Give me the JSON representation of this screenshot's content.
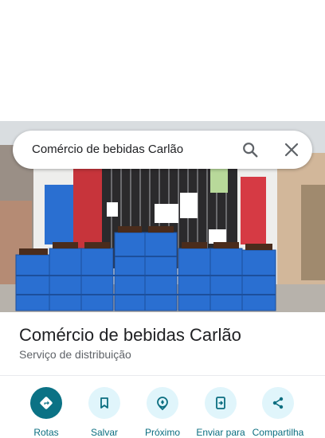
{
  "search": {
    "query": "Comércio de bebidas Carlão"
  },
  "place": {
    "title": "Comércio de bebidas Carlão",
    "category": "Serviço de distribuição"
  },
  "actions": [
    {
      "label": "Rotas",
      "icon": "directions-icon"
    },
    {
      "label": "Salvar",
      "icon": "bookmark-icon"
    },
    {
      "label": "Próximo",
      "icon": "nearby-icon"
    },
    {
      "label": "Enviar para",
      "icon": "send-to-phone-icon"
    },
    {
      "label": "Compartilha",
      "icon": "share-icon"
    }
  ],
  "colors": {
    "accent": "#0b7285",
    "action_bg": "#e0f5fb",
    "crate_blue": "#2a6fd1"
  }
}
